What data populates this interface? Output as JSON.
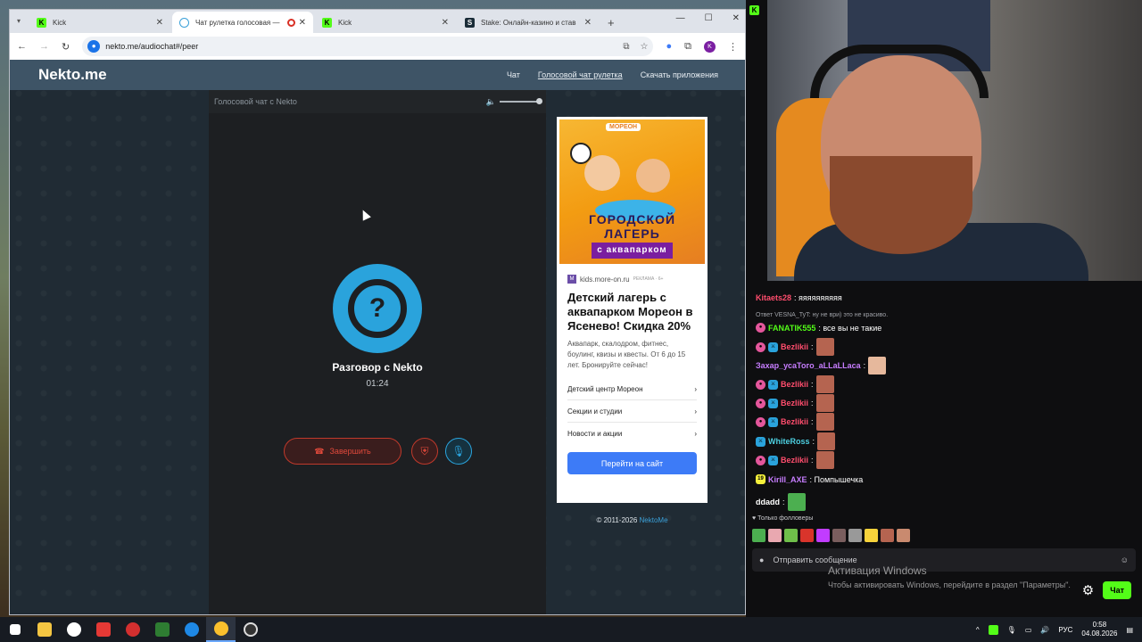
{
  "browser": {
    "tabs": [
      {
        "title": "Kick",
        "icon": "kick-favicon",
        "active": false
      },
      {
        "title": "Чат рулетка голосовая — ",
        "icon": "nekto-favicon",
        "active": true
      },
      {
        "title": "Kick",
        "icon": "kick-favicon",
        "active": false
      },
      {
        "title": "Stake: Онлайн-казино и став",
        "icon": "stake-favicon",
        "active": false
      }
    ],
    "url": "nekto.me/audiochat#/peer"
  },
  "site": {
    "logo": "Nekto.me",
    "nav": [
      "Чат",
      "Голосовой чат рулетка",
      "Скачать приложения"
    ],
    "panel_title": "Голосовой чат с Nekto",
    "call_title": "Разговор с Nekto",
    "call_time": "01:24",
    "end_button": "Завершить",
    "copyright_prefix": "© 2011-2026 ",
    "copyright_link": "NektoMe"
  },
  "ad": {
    "brand": "МОРЕОН",
    "banner_line1": "ГОРОДСКОЙ",
    "banner_line2": "ЛАГЕРЬ",
    "banner_line3": "с аквапарком",
    "source": "kids.more-on.ru",
    "ad_label": "РЕКЛАМА · 6+",
    "headline": "Детский лагерь с аквапарком Мореон в Ясенево! Скидка 20%",
    "body": "Аквапарк, скалодром, фитнес, боулинг, квизы и квесты. От 6 до 15 лет. Бронируйте сейчас!",
    "links": [
      "Детский центр Мореон",
      "Секции и студии",
      "Новости и акции"
    ],
    "cta": "Перейти на сайт"
  },
  "chat": {
    "messages": [
      {
        "user": "Kitaets28",
        "text": ": яяяяяяяяяя",
        "color": "#ff4d6d"
      },
      {
        "user": "FANATIK555",
        "text": ": все вы не такие",
        "color": "#53fc18"
      },
      {
        "user": "Bezlikii",
        "text": ":",
        "color": "#ff4d6d"
      },
      {
        "user": "Захар_усаТого_аLLaLLaca",
        "text": ":",
        "color": "#c77dff"
      },
      {
        "user": "Bezlikii",
        "text": ":",
        "color": "#ff4d6d"
      },
      {
        "user": "Bezlikii",
        "text": ":",
        "color": "#ff4d6d"
      },
      {
        "user": "Bezlikii",
        "text": ":",
        "color": "#ff4d6d"
      },
      {
        "user": "WhiteRoss",
        "text": ":",
        "color": "#4dd0e1"
      },
      {
        "user": "Bezlikii",
        "text": ":",
        "color": "#ff4d6d"
      },
      {
        "user": "Kirill_AXE",
        "text": ": Помпышечка",
        "color": "#c77dff"
      },
      {
        "user": "ddadd",
        "text": ":",
        "color": "#ffffff"
      }
    ],
    "reply_note": "Ответ VESNA_TyT: ну не ври) это не красиво.",
    "followers_only": "Только фолловеры",
    "input_placeholder": "Отправить сообщение",
    "chat_button": "Чат"
  },
  "windows": {
    "activation_title": "Активация Windows",
    "activation_text": "Чтобы активировать Windows, перейдите в раздел \"Параметры\".",
    "lang": "РУС",
    "time": "0:58",
    "date": "04.08.2026"
  }
}
